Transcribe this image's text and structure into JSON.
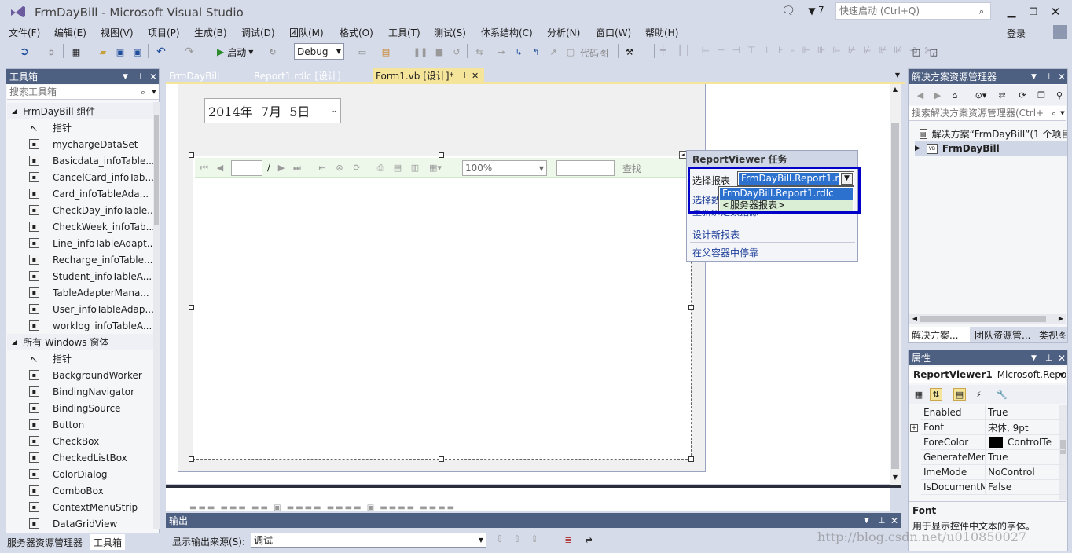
{
  "window": {
    "title": "FrmDayBill - Microsoft Visual Studio",
    "notifications": "7",
    "quick_launch_placeholder": "快速启动 (Ctrl+Q)",
    "signin": "登录"
  },
  "menu": [
    "文件(F)",
    "编辑(E)",
    "视图(V)",
    "项目(P)",
    "生成(B)",
    "调试(D)",
    "团队(M)",
    "格式(O)",
    "工具(T)",
    "测试(S)",
    "体系结构(C)",
    "分析(N)",
    "窗口(W)",
    "帮助(H)"
  ],
  "toolbar": {
    "start_label": "启动",
    "config_value": "Debug",
    "code_map_label": "代码图"
  },
  "toolbox": {
    "title": "工具箱",
    "search_placeholder": "搜索工具箱",
    "category1": "FrmDayBill 组件",
    "items1": [
      "指针",
      "mychargeDataSet",
      "Basicdata_infoTable...",
      "CancelCard_infoTab...",
      "Card_infoTableAda...",
      "CheckDay_infoTable...",
      "CheckWeek_infoTab...",
      "Line_infoTableAdapt...",
      "Recharge_infoTable...",
      "Student_infoTableA...",
      "TableAdapterMana...",
      "User_infoTableAdap...",
      "worklog_infoTableA..."
    ],
    "category2": "所有 Windows 窗体",
    "items2": [
      "指针",
      "BackgroundWorker",
      "BindingNavigator",
      "BindingSource",
      "Button",
      "CheckBox",
      "CheckedListBox",
      "ColorDialog",
      "ComboBox",
      "ContextMenuStrip",
      "DataGridView"
    ],
    "bottom_tab1": "服务器资源管理器",
    "bottom_tab2": "工具箱"
  },
  "tabs": [
    {
      "label": "FrmDayBill"
    },
    {
      "label": "Report1.rdlc [设计]"
    },
    {
      "label": "Form1.vb [设计]*"
    }
  ],
  "designer": {
    "date_value": "2014年  7月  5日",
    "zoom_value": "100%",
    "find_label": "查找",
    "separator": "/"
  },
  "smart_tag": {
    "title": "ReportViewer 任务",
    "choose_report_label": "选择报表",
    "choose_report_value": "FrmDayBill.Report1.r",
    "option1": "FrmDayBill.Report1.rdlc",
    "option2": "<服务器报表>",
    "choose_datasource_prefix": "选择数",
    "rebind_suffix": "重新绑定数据源",
    "design_new": "设计新报表",
    "dock": "在父容器中停靠"
  },
  "solution": {
    "title": "解决方案资源管理器",
    "search_placeholder": "搜索解决方案资源管理器(Ctrl+",
    "root": "解决方案“FrmDayBill”(1 个项目",
    "project": "FrmDayBill",
    "tab1": "解决方案...",
    "tab2": "团队资源管...",
    "tab3": "类视图"
  },
  "properties": {
    "title": "属性",
    "object_name": "ReportViewer1",
    "object_type": "Microsoft.Repo",
    "rows": [
      {
        "k": "Enabled",
        "v": "True"
      },
      {
        "k": "Font",
        "v": "宋体, 9pt"
      },
      {
        "k": "ForeColor",
        "v": "ControlTe"
      },
      {
        "k": "GenerateMer",
        "v": "True"
      },
      {
        "k": "ImeMode",
        "v": "NoControl"
      },
      {
        "k": "IsDocumentM",
        "v": "False"
      }
    ],
    "desc_title": "Font",
    "desc_text": "用于显示控件中文本的字体。"
  },
  "output": {
    "title": "输出",
    "source_label": "显示输出来源(S):",
    "source_value": "调试"
  },
  "watermark": "http://blog.csdn.net/u010850027",
  "colors": {
    "accent": "#0000c8",
    "tab_active": "#f5e59b",
    "panel_head": "#4d6082",
    "bg": "#d6dbe9"
  }
}
